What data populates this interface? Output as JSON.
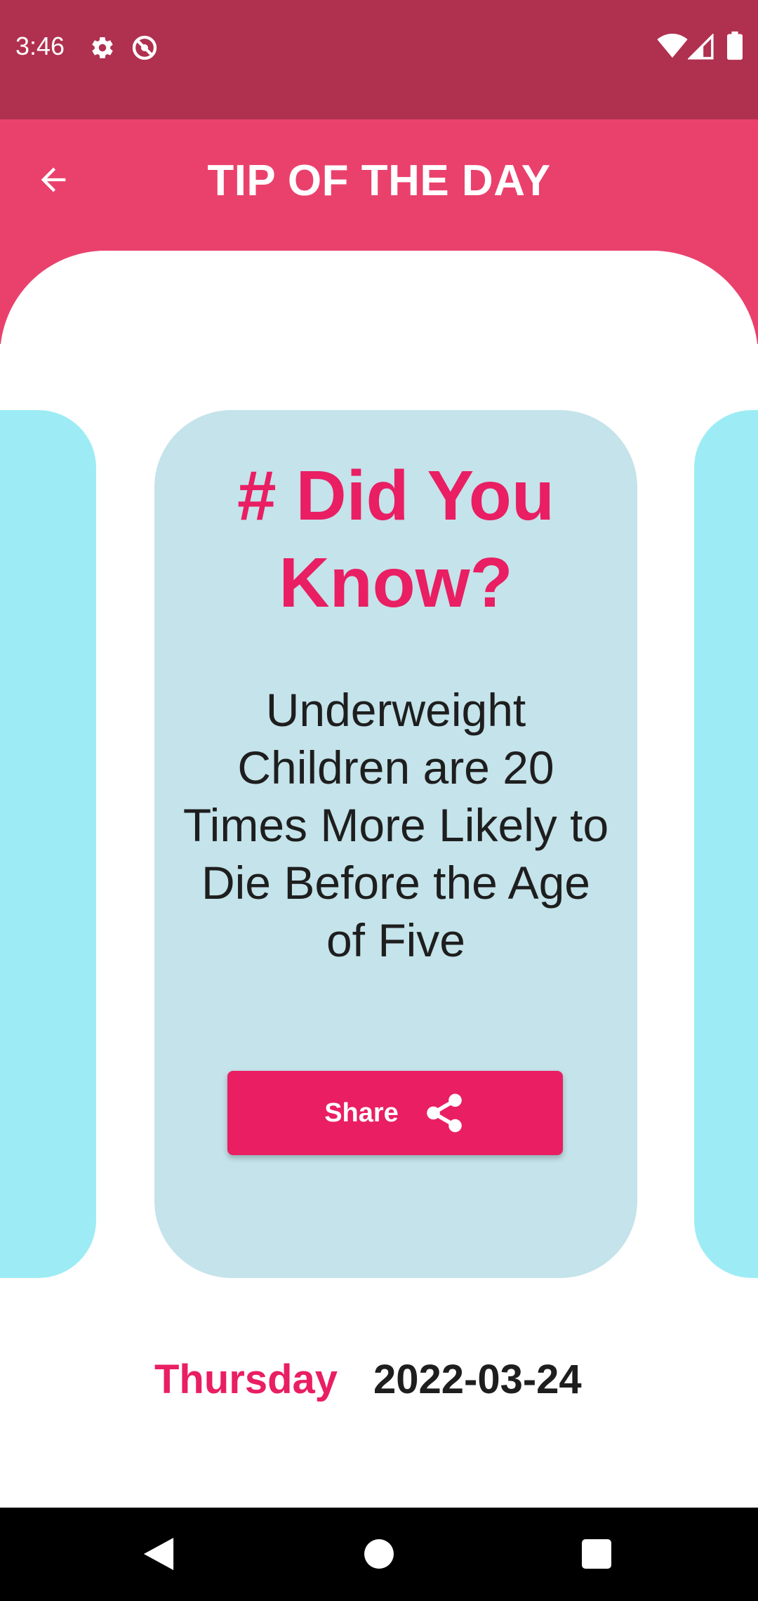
{
  "status_bar": {
    "time": "3:46",
    "icons_left": [
      "gear-icon",
      "no-sync-icon"
    ],
    "icons_right": [
      "wifi-icon",
      "cell-signal-icon",
      "battery-icon"
    ]
  },
  "app_bar": {
    "title": "TIP OF THE DAY",
    "back_icon": "arrow-left-icon"
  },
  "tip_card": {
    "heading": "# Did You\nKnow?",
    "body": "Underweight Children are 20 Times More Likely to Die Before the Age of Five",
    "share_label": "Share",
    "share_icon": "share-icon"
  },
  "date_row": {
    "day": "Thursday",
    "date": "2022-03-24"
  },
  "nav_bar": {
    "buttons": [
      "back-triangle-icon",
      "home-circle-icon",
      "recents-square-icon"
    ]
  },
  "colors": {
    "status_bar": "#b0304f",
    "app_bar": "#ea416c",
    "accent": "#e91e63",
    "card": "#c4e3ea",
    "side_card": "#9decf5",
    "text_dark": "#1e1e1e"
  }
}
